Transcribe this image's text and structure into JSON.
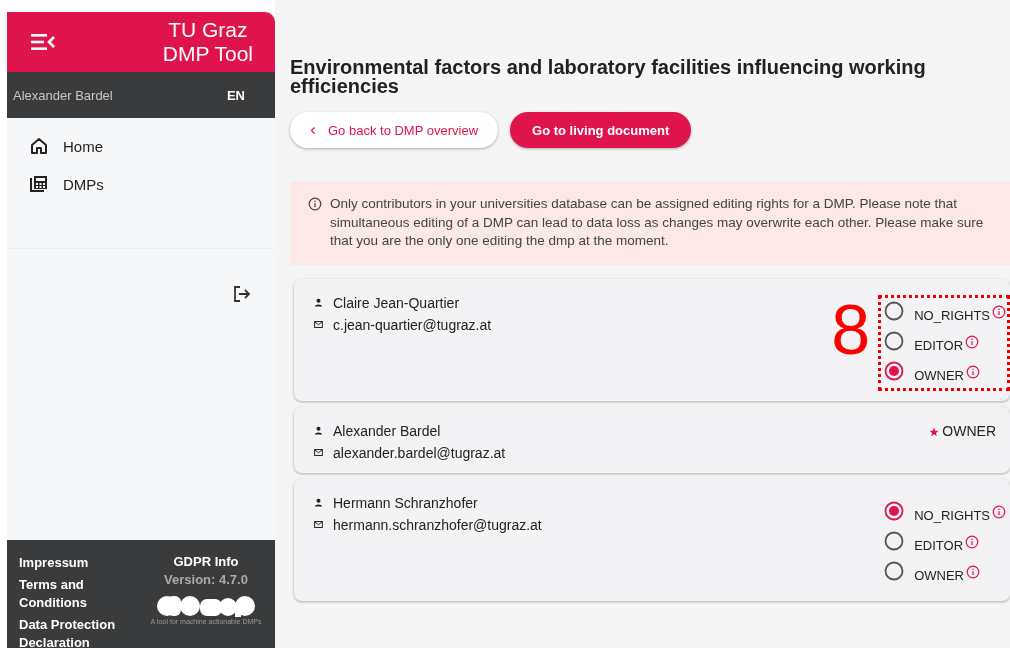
{
  "sidebar": {
    "title_lines": [
      "TU Graz",
      "DMP Tool"
    ],
    "user": "Alexander Bardel",
    "language": "EN",
    "nav": [
      {
        "label": "Home"
      },
      {
        "label": "DMPs"
      }
    ],
    "footer": {
      "links": [
        "Impressum",
        "Terms and Conditions",
        "Data Protection Declaration"
      ],
      "gdpr": "GDPR Info",
      "version": "Version: 4.7.0",
      "tagline": "A tool for machine actionable DMPs"
    }
  },
  "page": {
    "title": "Environmental factors and laboratory facilities influencing working efficiencies",
    "back_button": "Go back to DMP overview",
    "primary_button": "Go to living document",
    "notice": "Only contributors in your universities database can be assigned editing rights for a DMP. Please note that simultaneous editing of a DMP can lead to data loss as changes may overwrite each other. Please make sure that you are the only one editing the dmp at the moment."
  },
  "contributors": [
    {
      "name": "Claire Jean-Quartier",
      "email": "c.jean-quartier@tugraz.at",
      "kind": "radio",
      "annotation": "8",
      "options": [
        {
          "label": "NO_RIGHTS",
          "selected": false
        },
        {
          "label": "EDITOR",
          "selected": false
        },
        {
          "label": "OWNER",
          "selected": true
        }
      ]
    },
    {
      "name": "Alexander Bardel",
      "email": "alexander.bardel@tugraz.at",
      "kind": "fixed",
      "role": "OWNER"
    },
    {
      "name": "Hermann Schranzhofer",
      "email": "hermann.schranzhofer@tugraz.at",
      "kind": "radio",
      "options": [
        {
          "label": "NO_RIGHTS",
          "selected": true
        },
        {
          "label": "EDITOR",
          "selected": false
        },
        {
          "label": "OWNER",
          "selected": false
        }
      ]
    }
  ]
}
